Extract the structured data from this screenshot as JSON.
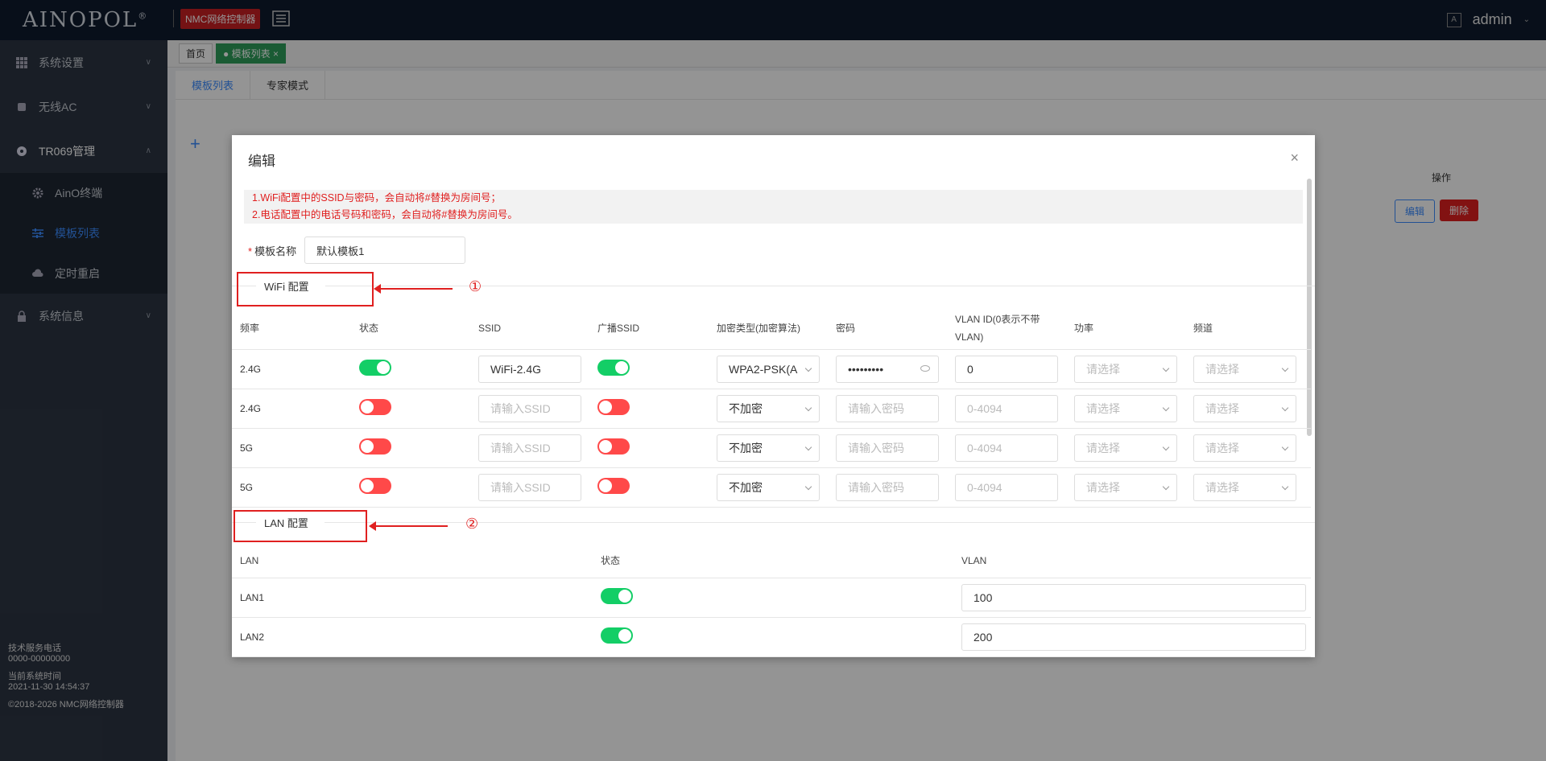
{
  "topbar": {
    "logo": "AINOPOL",
    "logo_mark": "®",
    "brand": "NMC网络控制器",
    "lang_icon": "A",
    "user": "admin"
  },
  "sidebar": {
    "items": [
      {
        "label": "系统设置",
        "icon": "grid-icon"
      },
      {
        "label": "无线AC",
        "icon": "chip-icon"
      },
      {
        "label": "TR069管理",
        "icon": "circle-icon"
      },
      {
        "label": "系统信息",
        "icon": "lock-icon"
      }
    ],
    "sub_items": [
      {
        "label": "AinO终端",
        "icon": "gear-icon"
      },
      {
        "label": "模板列表",
        "icon": "sliders-icon"
      },
      {
        "label": "定时重启",
        "icon": "cloud-icon"
      }
    ],
    "footer": {
      "support_label": "技术服务电话",
      "support_phone": "0000-00000000",
      "time_label": "当前系统时间",
      "time_value": "2021-11-30 14:54:37",
      "copyright": "©2018-2026 NMC网络控制器"
    }
  },
  "main": {
    "page_tabs": [
      {
        "label": "首页"
      },
      {
        "label": "模板列表"
      }
    ],
    "content_tabs": [
      {
        "label": "模板列表"
      },
      {
        "label": "专家模式"
      }
    ],
    "table_header_action": "操作",
    "edit_btn": "编辑",
    "delete_btn": "删除"
  },
  "modal": {
    "title": "编辑",
    "close": "×",
    "notices": [
      "1.WiFi配置中的SSID与密码，会自动将#替换为房间号；",
      "2.电话配置中的电话号码和密码，会自动将#替换为房间号。"
    ],
    "name_label": "模板名称",
    "name_value": "默认模板1",
    "wifi_section": "WiFi 配置",
    "lan_section": "LAN 配置",
    "annotation_1": "①",
    "annotation_2": "②",
    "wifi_headers": [
      "频率",
      "状态",
      "SSID",
      "广播SSID",
      "加密类型(加密算法)",
      "密码",
      "VLAN ID(0表示不带VLAN)",
      "功率",
      "频道"
    ],
    "wifi_rows": [
      {
        "freq": "2.4G",
        "status": "on",
        "ssid": "WiFi-2.4G",
        "broadcast": "on",
        "enc": "WPA2-PSK(A",
        "pwd": "•••••••••",
        "vlan": "0",
        "power": "请选择",
        "channel": "请选择"
      },
      {
        "freq": "2.4G",
        "status": "off",
        "ssid": "请输入SSID",
        "broadcast": "off",
        "enc": "不加密",
        "pwd": "请输入密码",
        "vlan": "0-4094",
        "power": "请选择",
        "channel": "请选择"
      },
      {
        "freq": "5G",
        "status": "off",
        "ssid": "请输入SSID",
        "broadcast": "off",
        "enc": "不加密",
        "pwd": "请输入密码",
        "vlan": "0-4094",
        "power": "请选择",
        "channel": "请选择"
      },
      {
        "freq": "5G",
        "status": "off",
        "ssid": "请输入SSID",
        "broadcast": "off",
        "enc": "不加密",
        "pwd": "请输入密码",
        "vlan": "0-4094",
        "power": "请选择",
        "channel": "请选择"
      }
    ],
    "lan_headers": [
      "LAN",
      "状态",
      "VLAN"
    ],
    "lan_rows": [
      {
        "name": "LAN1",
        "status": "on",
        "vlan": "100"
      },
      {
        "name": "LAN2",
        "status": "on",
        "vlan": "200"
      }
    ]
  },
  "colors": {
    "topbar": "#0f1b2d",
    "sidebar": "#2c3543",
    "accent": "#3b8cff",
    "toggle_on": "#13ce66",
    "toggle_off": "#ff4949",
    "annotation": "#e02020"
  }
}
